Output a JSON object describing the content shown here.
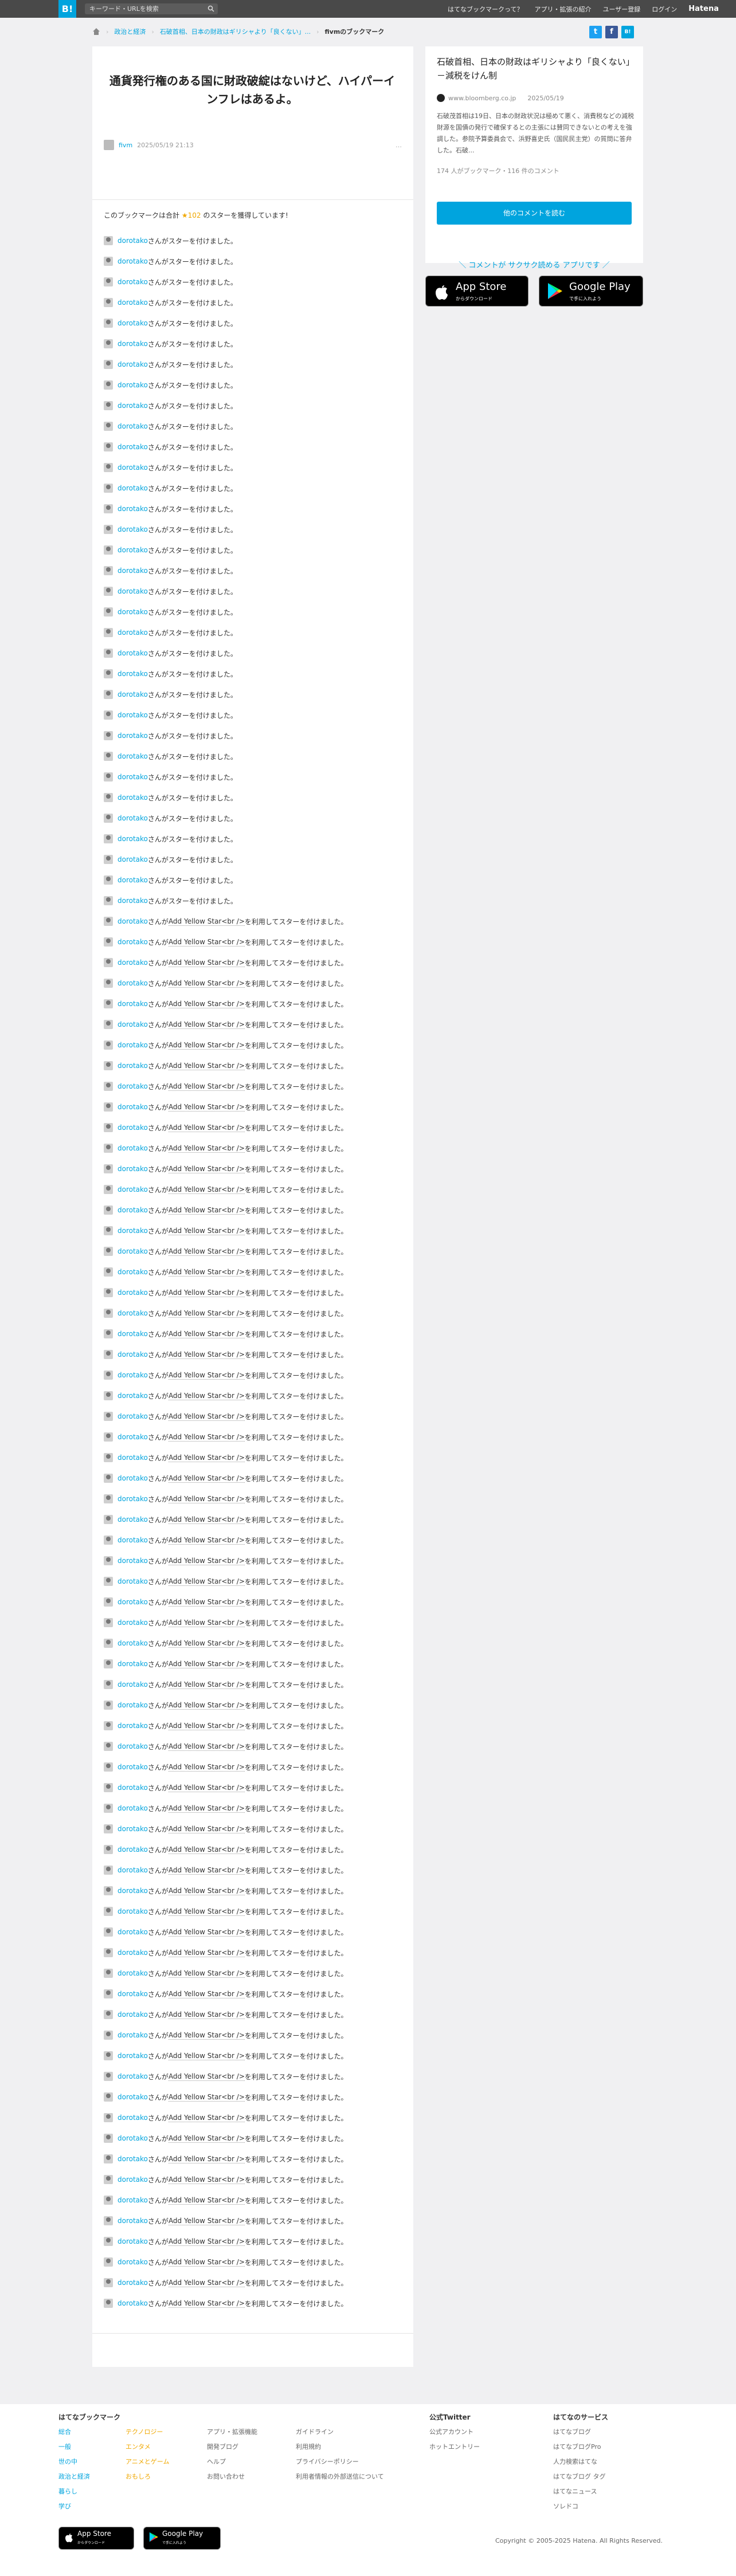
{
  "header": {
    "logo": "B!",
    "search_placeholder": "キーワード・URLを検索",
    "nav": [
      "はてなブックマークって？",
      "アプリ・拡張の紹介",
      "ユーザー登録",
      "ログイン",
      "Hatena"
    ]
  },
  "breadcrumb": [
    "政治と経済",
    "石破首相、日本の財政はギリシャより「良くない」...",
    "fivmのブックマーク"
  ],
  "main": {
    "title": "通貨発行権のある国に財政破綻はないけど、ハイパーインフレはあるよ。",
    "username": "fivm",
    "timestamp": "2025/05/19 21:13",
    "more": "…",
    "count_prefix": "このブックマークは合計",
    "count_star": "★102",
    "count_suffix": "のスターを獲得しています!",
    "star_user": "dorotako",
    "san": "さん",
    "action_simple": "がスターを付けました。",
    "action_ga": "が",
    "star_name": "Add Yellow Star<br />",
    "action_used": "を利用してスターを付けました。",
    "simple_count": 33,
    "used_count": 68
  },
  "share": {
    "twitter": "t",
    "facebook": "f",
    "hatena": "B!"
  },
  "sidebar": {
    "article_title": "石破首相、日本の財政はギリシャより「良くない」－減税をけん制",
    "domain": "www.bloomberg.co.jp",
    "date": "2025/05/19",
    "description": "石破茂首相は19日、日本の財政状況は極めて悪く、消費税などの減税財源を国債の発行で確保するとの主張には賛同できないとの考えを強調した。参院予算委員会で、浜野喜史氏（国民民主党）の質問に答弁した。石破...",
    "counts": "174 人がブックマーク・116 件のコメント",
    "button": "他のコメントを読む",
    "app_promo": "＼ コメントが サクサク読める アプリです ／"
  },
  "stores": {
    "appstore_big": "App Store",
    "appstore_small": "からダウンロード",
    "google_big": "Google Play",
    "google_small": "で手に入れよう"
  },
  "footer": {
    "brand": "はてなブックマーク",
    "col1": [
      "総合",
      "一般",
      "世の中",
      "政治と経済",
      "暮らし",
      "学び"
    ],
    "col2": [
      "テクノロジー",
      "エンタメ",
      "アニメとゲーム",
      "おもしろ"
    ],
    "col3": [
      "アプリ・拡張機能",
      "開発ブログ",
      "ヘルプ",
      "お問い合わせ"
    ],
    "col4": [
      "ガイドライン",
      "利用規約",
      "プライバシーポリシー",
      "利用者情報の外部送信について"
    ],
    "twitter_head": "公式Twitter",
    "twitter_links": [
      "公式アカウント",
      "ホットエントリー"
    ],
    "services_head": "はてなのサービス",
    "services": [
      "はてなブログ",
      "はてなブログPro",
      "人力検索はてな",
      "はてなブログ タグ",
      "はてなニュース",
      "ソレドコ"
    ],
    "copyright": "Copyright © 2005-2025 Hatena. All Rights Reserved."
  }
}
